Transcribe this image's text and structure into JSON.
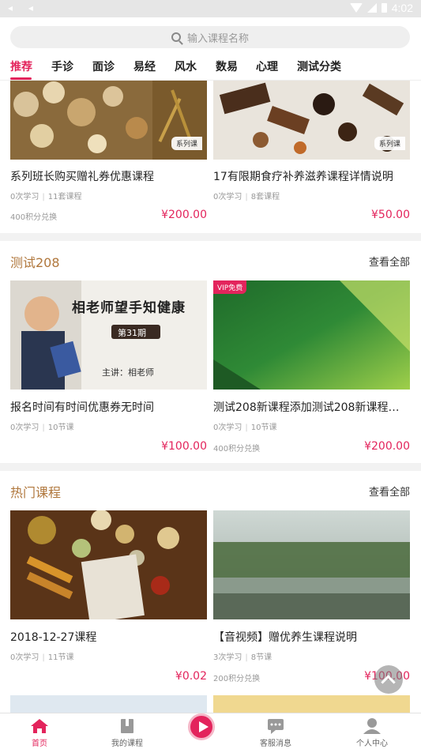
{
  "status_bar": {
    "time": "4:02"
  },
  "search": {
    "placeholder": "输入课程名称"
  },
  "tabs": [
    {
      "label": "推荐"
    },
    {
      "label": "手诊"
    },
    {
      "label": "面诊"
    },
    {
      "label": "易经"
    },
    {
      "label": "风水"
    },
    {
      "label": "数易"
    },
    {
      "label": "心理"
    },
    {
      "label": "测试分类"
    }
  ],
  "top_courses": [
    {
      "title": "系列班长购买赠礼券优惠课程",
      "learners": "0次学习",
      "lessons": "11套课程",
      "points": "400积分兑换",
      "price": "¥200.00",
      "tag": "系列课"
    },
    {
      "title": "17有限期食疗补养滋养课程详情说明",
      "learners": "0次学习",
      "lessons": "8套课程",
      "points": "",
      "price": "¥50.00",
      "tag": "系列课"
    }
  ],
  "sections": [
    {
      "title": "测试208",
      "more": "查看全部",
      "courses": [
        {
          "title": "报名时间有时间优惠券无时间",
          "learners": "0次学习",
          "lessons": "10节课",
          "points": "",
          "price": "¥100.00",
          "image_text": "相老师望手知健康",
          "image_sub": "第31期",
          "image_author": "主讲：相老师"
        },
        {
          "title": "测试208新课程添加测试208新课程添…",
          "learners": "0次学习",
          "lessons": "10节课",
          "points": "400积分兑换",
          "price": "¥200.00",
          "badge": "VIP免费"
        }
      ]
    },
    {
      "title": "热门课程",
      "more": "查看全部",
      "courses": [
        {
          "title": "2018-12-27课程",
          "learners": "0次学习",
          "lessons": "11节课",
          "points": "",
          "price": "¥0.02"
        },
        {
          "title": "【音视频】赠优养生课程说明",
          "learners": "3次学习",
          "lessons": "8节课",
          "points": "200积分兑换",
          "price": "¥100.00"
        }
      ]
    }
  ],
  "tabbar": [
    {
      "label": "首页",
      "icon": "home-icon"
    },
    {
      "label": "我的课程",
      "icon": "book-icon"
    },
    {
      "label": "",
      "icon": "play-icon"
    },
    {
      "label": "客服消息",
      "icon": "chat-icon"
    },
    {
      "label": "个人中心",
      "icon": "user-icon"
    }
  ],
  "colors": {
    "accent": "#e3245c",
    "section_title": "#b0773c"
  }
}
